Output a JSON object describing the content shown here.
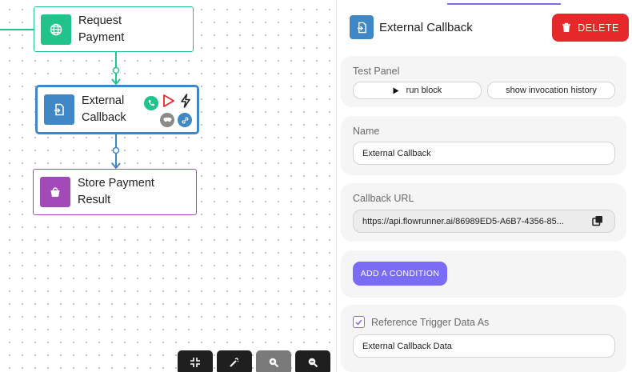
{
  "canvas": {
    "nodes": [
      {
        "id": "request",
        "label": "Request Payment",
        "icon": "globe-icon"
      },
      {
        "id": "callback",
        "label": "External Callback",
        "icon": "callback-icon",
        "badges": [
          "phone-icon",
          "play-icon",
          "bolt-icon",
          "mask-icon",
          "link-icon"
        ]
      },
      {
        "id": "store",
        "label": "Store Payment Result",
        "icon": "bag-icon"
      }
    ],
    "zoom_controls": [
      "shrink-icon",
      "magic-wand-icon",
      "zoom-in-icon",
      "zoom-out-icon"
    ]
  },
  "panel": {
    "title": "External Callback",
    "delete_label": "DELETE",
    "test_panel": {
      "label": "Test Panel",
      "run_label": "run block",
      "history_label": "show invocation history"
    },
    "name": {
      "label": "Name",
      "value": "External Callback"
    },
    "callback_url": {
      "label": "Callback URL",
      "value": "https://api.flowrunner.ai/86989ED5-A6B7-4356-85..."
    },
    "add_condition_label": "ADD A CONDITION",
    "reference": {
      "label": "Reference Trigger Data As",
      "checked": true,
      "value": "External Callback Data"
    }
  },
  "colors": {
    "green": "#22c38a",
    "blue": "#3f88c5",
    "purple": "#a24ab8",
    "accent": "#7b6cf6",
    "danger": "#e5292a"
  }
}
